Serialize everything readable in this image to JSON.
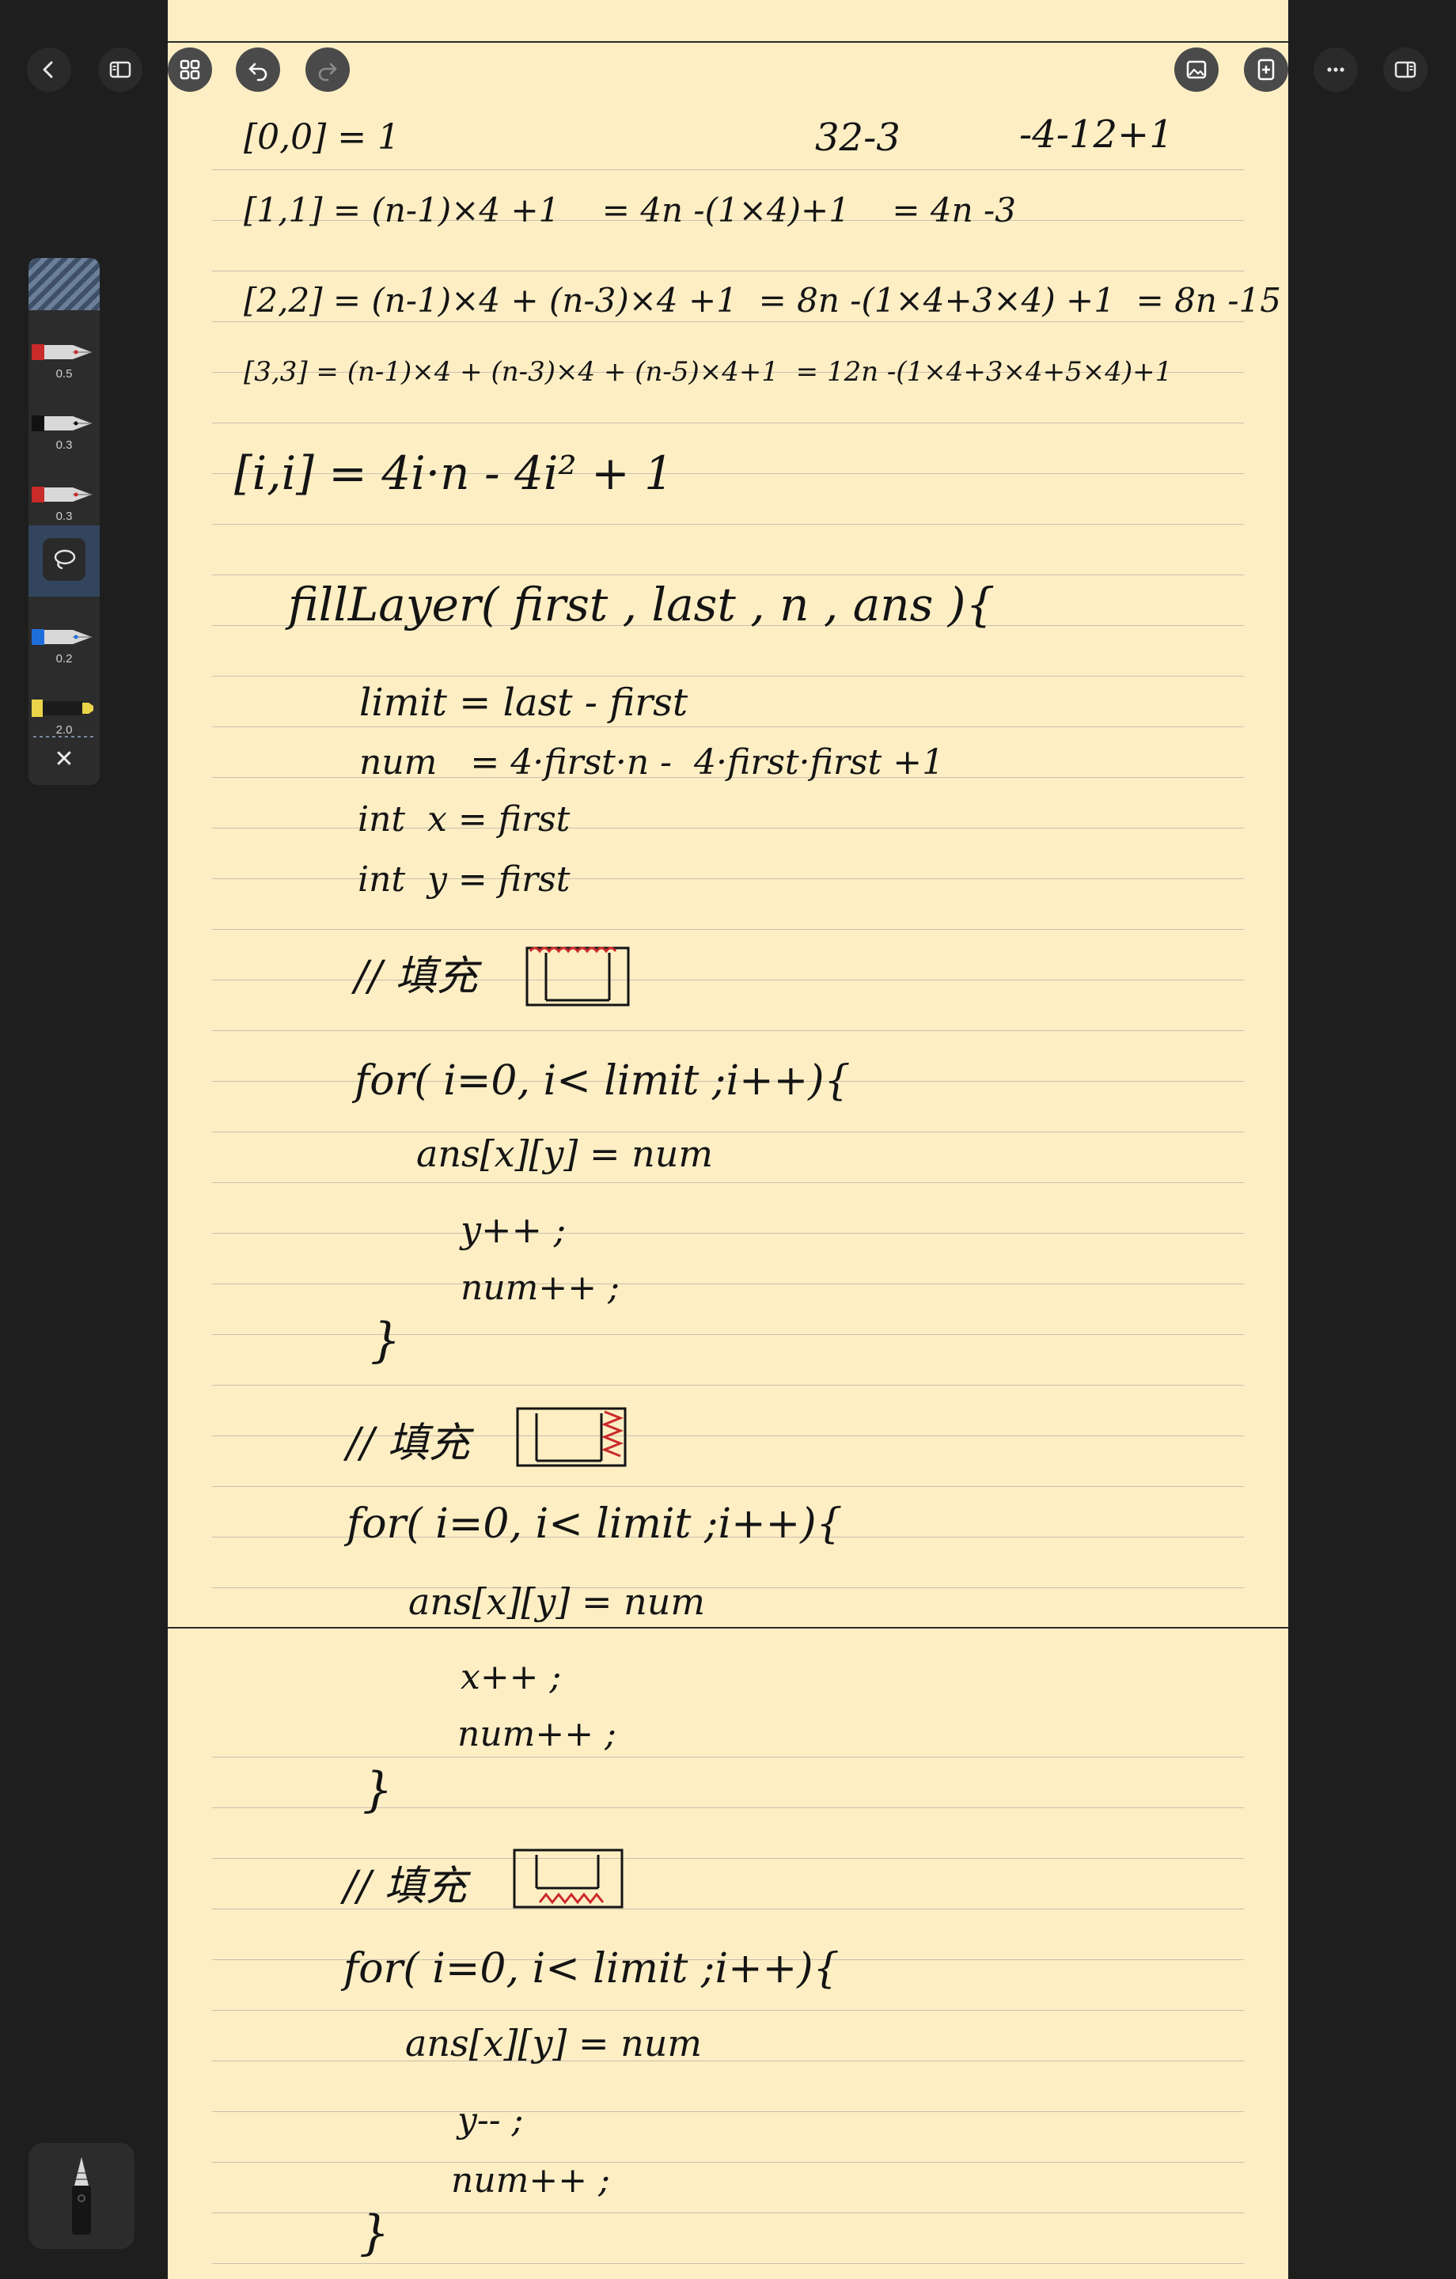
{
  "toolbar": {
    "left": [
      "back",
      "sidebar",
      "grid",
      "undo",
      "redo"
    ],
    "right": [
      "image",
      "add-page",
      "more",
      "panel"
    ]
  },
  "pens": [
    {
      "size": "0.5",
      "color": "#c92a2a"
    },
    {
      "size": "0.3",
      "color": "#111111"
    },
    {
      "size": "0.3",
      "color": "#c92a2a"
    },
    {
      "size": "0.2",
      "color": "#1e6fd9"
    },
    {
      "size": "2.0",
      "color": "#e9d44a"
    }
  ],
  "notes": {
    "lines": [
      "[0,0] = 1",
      "[1,1] = (n-1)×4 +1    = 4n -(1×4)+1    = 4n -3",
      "[2,2] = (n-1)×4 + (n-3)×4 +1  = 8n -(1×4+3×4) +1  = 8n -15",
      "[3,3] = (n-1)×4 + (n-3)×4 + (n-5)×4+1  = 12n -(1×4+3×4+5×4)+1",
      "[i,i] = 4i·n - 4i² + 1",
      "fillLayer( first , last , n , ans ){",
      "limit = last - first",
      "num   = 4·first·n -  4·first·first +1",
      "int  x = first",
      "int  y = first",
      "// 填充",
      "for( i=0, i< limit ;i++){",
      "ans[x][y] = num",
      "y++ ;",
      "num++ ;",
      "}",
      "// 填充",
      "for( i=0, i< limit ;i++){",
      "ans[x][y] = num",
      "x++ ;",
      "num++ ;",
      "}",
      "// 填充",
      "for( i=0, i< limit ;i++){",
      "ans[x][y] = num",
      "y-- ;",
      "num++ ;",
      "}"
    ],
    "margin_note_1": "32-3",
    "margin_note_2": "-4-12+1"
  }
}
